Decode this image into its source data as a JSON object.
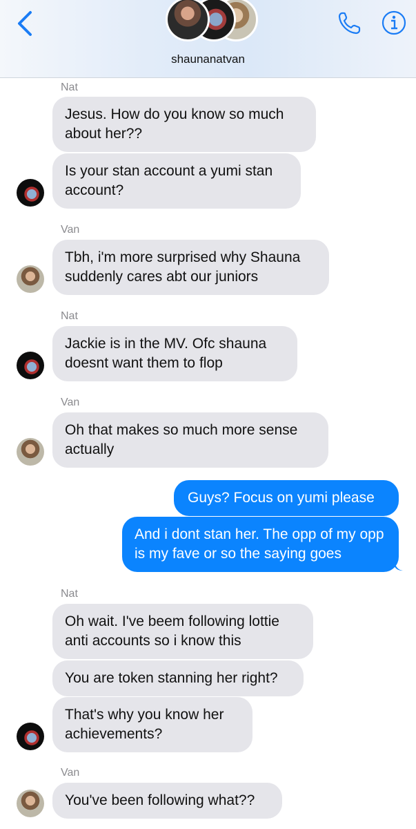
{
  "header": {
    "group_name": "shaunanatvan",
    "back_icon": "chevron-left-icon",
    "call_icon": "phone-icon",
    "info_icon": "info-icon",
    "accent": "#1a7cf5"
  },
  "colors": {
    "incoming": "#e5e5ea",
    "outgoing": "#0b84fe"
  },
  "messages": [
    {
      "sender": "Nat",
      "text": "Jesus. How do you know so much about her??"
    },
    {
      "sender": "Nat",
      "text": "Is your stan account a yumi stan account?"
    },
    {
      "sender": "Van",
      "text": "Tbh, i'm more surprised why Shauna suddenly cares abt our juniors"
    },
    {
      "sender": "Nat",
      "text": "Jackie is in the MV. Ofc shauna doesnt want them to flop"
    },
    {
      "sender": "Van",
      "text": "Oh that makes so much more sense actually"
    },
    {
      "sender": "me",
      "text": "Guys? Focus on yumi please"
    },
    {
      "sender": "me",
      "text": "And i dont stan her. The opp of my opp is my fave or so the saying goes"
    },
    {
      "sender": "Nat",
      "text": "Oh wait. I've beem following lottie anti accounts so i know this"
    },
    {
      "sender": "Nat",
      "text": "You are token stanning her right?"
    },
    {
      "sender": "Nat",
      "text": "That's why you know her achievements?"
    },
    {
      "sender": "Van",
      "text": "You've been following what??"
    }
  ]
}
